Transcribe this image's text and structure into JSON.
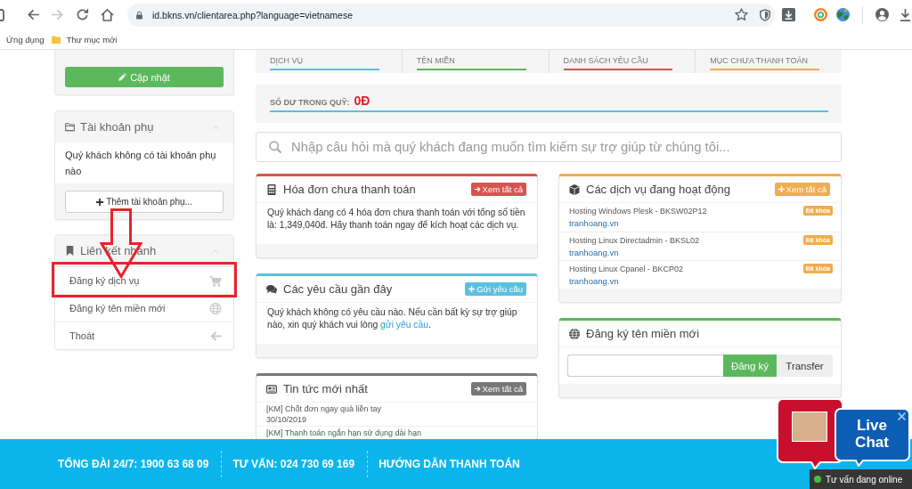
{
  "browser": {
    "url": "id.bkns.vn/clientarea.php?language=vietnamese",
    "forward_disabled": true,
    "bookmarks": [
      {
        "kind": "link",
        "label": "Ứng dụng"
      },
      {
        "kind": "folder",
        "label": "Thư mục mới"
      }
    ]
  },
  "sidebar": {
    "update_button": "Cập nhật",
    "panels": [
      {
        "kind": "message",
        "title": "Tài khoản phụ",
        "text": "Quý khách không có tài khoản phụ nào",
        "button": "Thêm tài khoản phụ..."
      },
      {
        "kind": "links",
        "title": "Liên kết nhanh",
        "items": [
          {
            "label": "Đăng ký dịch vụ",
            "annotated": true
          },
          {
            "label": "Đăng ký tên miền mới",
            "annotated": false
          },
          {
            "label": "Thoát",
            "annotated": false
          }
        ]
      }
    ]
  },
  "stats": [
    {
      "label": "DỊCH VỤ",
      "color": "#5bc0de"
    },
    {
      "label": "TÊN MIỀN",
      "color": "#5cb85c"
    },
    {
      "label": "DANH SÁCH YÊU CẦU",
      "color": "#d9534f"
    },
    {
      "label": "MỤC CHƯA THANH TOÁN",
      "color": "#f0ad4e"
    }
  ],
  "balance": {
    "label": "SỐ DƯ TRONG QUỸ:",
    "value": "0Đ"
  },
  "search": {
    "placeholder": "Nhập câu hỏi mà quý khách đang muốn tìm kiếm sự trợ giúp từ chúng tôi..."
  },
  "left_cards": [
    {
      "kind": "invoices",
      "color": "#d9534f",
      "title": "Hóa đơn chưa thanh toán",
      "button": "Xem tất cả",
      "text": "Quý khách đang có 4 hóa đơn chưa thanh toán với tổng số tiền là: 1,349,040đ. Hãy thanh toán ngay để kích hoạt các dịch vụ."
    },
    {
      "kind": "tickets",
      "color": "#5bc0de",
      "title": "Các yêu cầu gần đây",
      "button": "Gửi yêu cầu",
      "text": "Quý khách không có yêu cầu nào. Nếu cần bất kỳ sự trợ giúp nào, xin quý khách vui lòng",
      "link": "gửi yêu cầu",
      "text_end": "."
    },
    {
      "kind": "news",
      "color": "#777777",
      "title": "Tin tức mới nhất",
      "button": "Xem tất cả",
      "items": [
        {
          "title": "[KM] Chốt đơn ngay quà liền tay",
          "date": "30/10/2019"
        },
        {
          "title": "[KM] Thanh toán ngắn hạn sử dụng dài hạn"
        }
      ]
    }
  ],
  "right_cards": [
    {
      "kind": "services",
      "color": "#f0ad4e",
      "title": "Các dịch vụ đang hoạt động",
      "button": "Xem tất cả",
      "items": [
        {
          "name": "Hosting Windows Plesk - BKSW02P12",
          "domain": "tranhoang.vn",
          "status": "Đã khóa"
        },
        {
          "name": "Hosting Linux Directadmin - BKSL02",
          "domain": "tranhoang.vn",
          "status": "Đã khóa"
        },
        {
          "name": "Hosting Linux Cpanel - BKCP02",
          "domain": "tranhoang.vn",
          "status": "Đã khóa"
        }
      ]
    },
    {
      "kind": "domain",
      "color": "#5cb85c",
      "title": "Đăng ký tên miền mới",
      "buttons": [
        "Đăng ký",
        "Transfer"
      ]
    }
  ],
  "footer": {
    "items": [
      "TỔNG ĐÀI 24/7: 1900 63 68 09",
      "TƯ VẤN: 024 730 69 169",
      "HƯỚNG DẪN THANH TOÁN"
    ]
  },
  "live_chat": {
    "label": "Live Chat",
    "status": "Tư vấn đang online",
    "online": true
  }
}
